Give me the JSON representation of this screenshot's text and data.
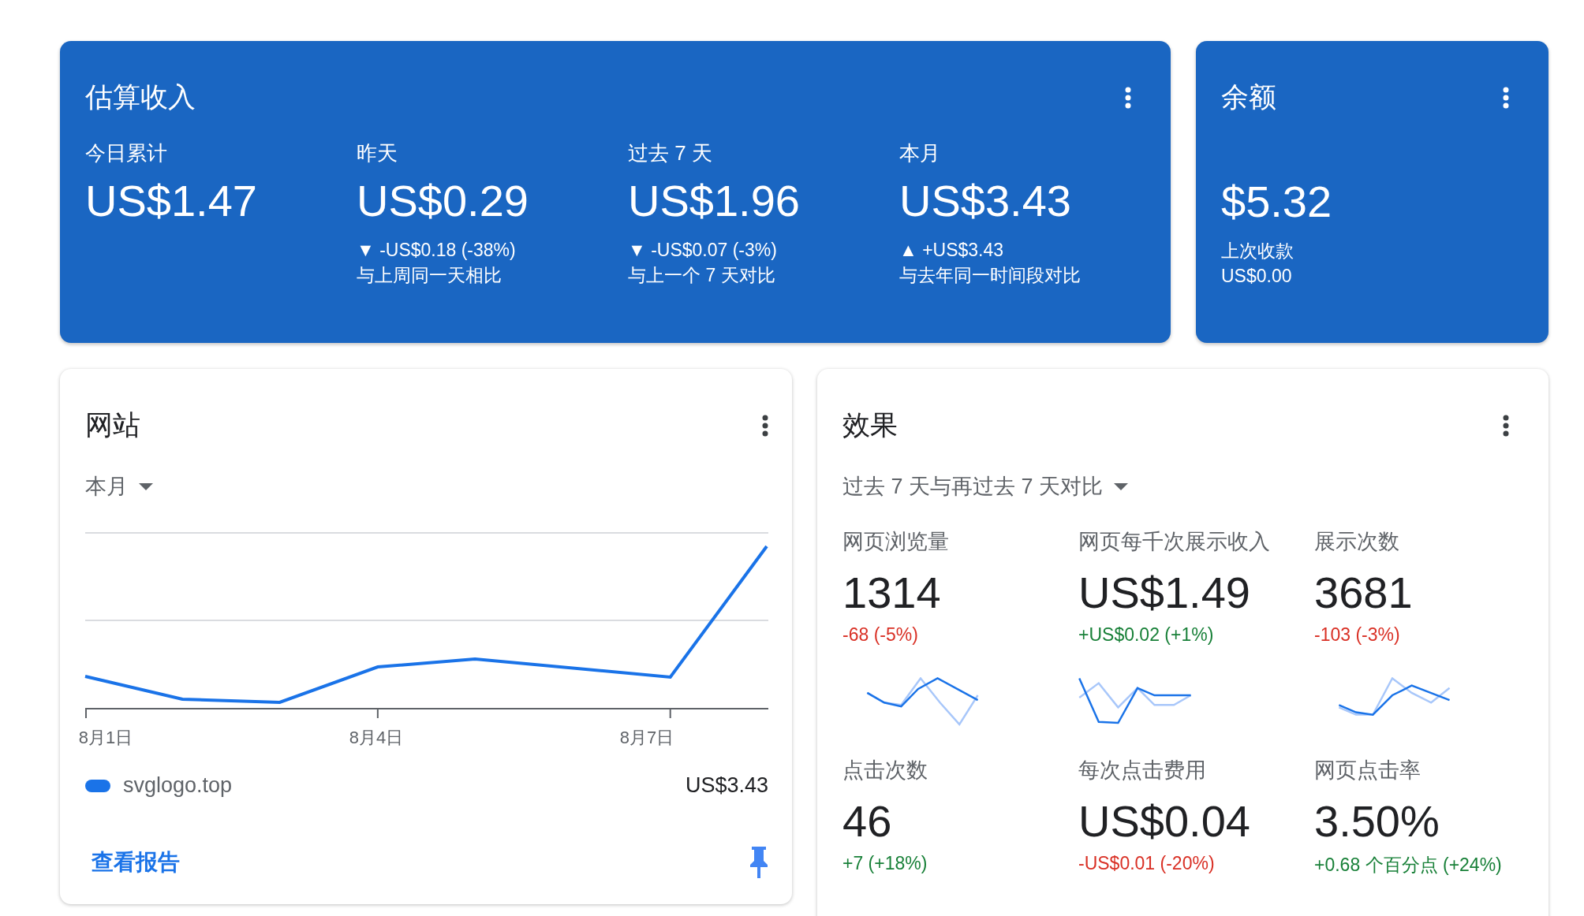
{
  "earnings": {
    "title": "估算收入",
    "periods": [
      {
        "label": "今日累计",
        "value": "US$1.47"
      },
      {
        "label": "昨天",
        "value": "US$0.29",
        "change": "▼ -US$0.18 (-38%)",
        "comparison": "与上周同一天相比"
      },
      {
        "label": "过去 7 天",
        "value": "US$1.96",
        "change": "▼ -US$0.07 (-3%)",
        "comparison": "与上一个 7 天对比"
      },
      {
        "label": "本月",
        "value": "US$3.43",
        "change": "▲ +US$3.43",
        "comparison": "与去年同一时间段对比"
      }
    ]
  },
  "balance": {
    "title": "余额",
    "value": "$5.32",
    "last_payment_label": "上次收款",
    "last_payment": "US$0.00"
  },
  "sites": {
    "title": "网站",
    "period": "本月",
    "x_labels": [
      "8月1日",
      "8月4日",
      "8月7日"
    ],
    "items": [
      {
        "name": "svglogo.top",
        "value": "US$3.43",
        "color": "#1a73e8"
      }
    ],
    "report_link": "查看报告"
  },
  "performance": {
    "title": "效果",
    "comparison": "过去 7 天与再过去 7 天对比",
    "metrics": [
      {
        "label": "网页浏览量",
        "value": "1314",
        "change": "-68 (-5%)",
        "color": "#d93025"
      },
      {
        "label": "网页每千次展示收入",
        "value": "US$1.49",
        "change": "+US$0.02 (+1%)",
        "color": "#188038"
      },
      {
        "label": "展示次数",
        "value": "3681",
        "change": "-103 (-3%)",
        "color": "#d93025"
      },
      {
        "label": "点击次数",
        "value": "46",
        "change": "+7 (+18%)",
        "color": "#188038"
      },
      {
        "label": "每次点击费用",
        "value": "US$0.04",
        "change": "-US$0.01 (-20%)",
        "color": "#d93025"
      },
      {
        "label": "网页点击率",
        "value": "3.50%",
        "change": "+0.68 个百分点 (+24%)",
        "color": "#188038"
      }
    ]
  }
}
